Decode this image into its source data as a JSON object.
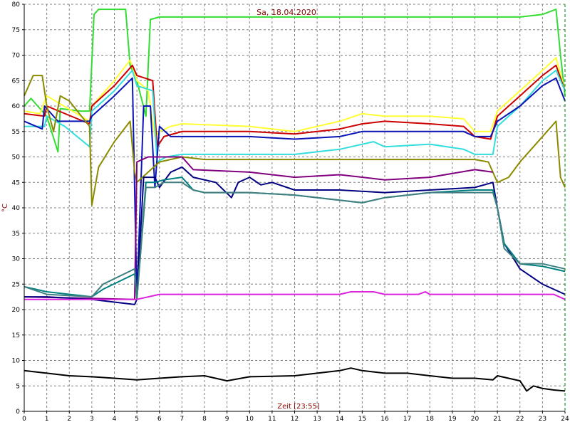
{
  "chart_data": {
    "type": "line",
    "title": "Sa, 18.04.2020",
    "xlabel": "Zeit [23:55]",
    "ylabel": "°C",
    "xlim": [
      0,
      24
    ],
    "ylim": [
      0,
      80
    ],
    "x_ticks": [
      0,
      1,
      2,
      3,
      4,
      5,
      6,
      7,
      8,
      9,
      10,
      11,
      12,
      13,
      14,
      15,
      16,
      17,
      18,
      19,
      20,
      21,
      22,
      23,
      24
    ],
    "y_ticks": [
      0,
      5,
      10,
      15,
      20,
      25,
      30,
      35,
      40,
      45,
      50,
      55,
      60,
      65,
      70,
      75,
      80
    ],
    "grid": true,
    "colors": {
      "grid": "#808080",
      "axis": "#000000",
      "title": "#8b0000",
      "right_marker": "#008000"
    },
    "series": [
      {
        "color": "#33dd33",
        "points": [
          [
            0,
            60
          ],
          [
            0.3,
            61.5
          ],
          [
            0.7,
            59.5
          ],
          [
            1.0,
            58
          ],
          [
            1.5,
            51
          ],
          [
            1.6,
            59.5
          ],
          [
            2.5,
            59
          ],
          [
            2.9,
            59
          ],
          [
            3.1,
            78
          ],
          [
            3.3,
            79
          ],
          [
            4.5,
            79
          ],
          [
            4.7,
            68
          ],
          [
            5.0,
            65
          ],
          [
            5.4,
            58
          ],
          [
            5.6,
            77
          ],
          [
            6.0,
            77.5
          ],
          [
            8,
            77.5
          ],
          [
            10,
            77.5
          ],
          [
            12,
            77.5
          ],
          [
            14,
            77.5
          ],
          [
            16,
            77.5
          ],
          [
            18,
            77.5
          ],
          [
            20,
            77.5
          ],
          [
            21,
            77.5
          ],
          [
            22,
            77.5
          ],
          [
            23,
            78
          ],
          [
            23.6,
            79
          ],
          [
            23.8,
            70
          ],
          [
            24,
            62
          ]
        ]
      },
      {
        "color": "#ffff33",
        "points": [
          [
            0,
            59
          ],
          [
            0.7,
            58.5
          ],
          [
            1.0,
            62
          ],
          [
            2.9,
            57
          ],
          [
            3.0,
            60
          ],
          [
            4.0,
            65
          ],
          [
            4.7,
            69
          ],
          [
            5.0,
            65
          ],
          [
            5.5,
            63
          ],
          [
            5.8,
            54
          ],
          [
            6.0,
            55
          ],
          [
            6.5,
            56
          ],
          [
            7,
            56.5
          ],
          [
            10,
            56
          ],
          [
            12,
            55
          ],
          [
            14,
            57
          ],
          [
            15,
            58.5
          ],
          [
            16,
            58
          ],
          [
            18,
            58
          ],
          [
            19.5,
            57.5
          ],
          [
            20,
            55
          ],
          [
            20.7,
            55
          ],
          [
            21,
            59
          ],
          [
            22,
            63
          ],
          [
            23,
            67
          ],
          [
            23.6,
            69.5
          ],
          [
            24,
            63
          ]
        ]
      },
      {
        "color": "#cc0000",
        "points": [
          [
            0,
            58.5
          ],
          [
            0.9,
            58
          ],
          [
            1.0,
            60
          ],
          [
            2.9,
            56.5
          ],
          [
            3.0,
            60
          ],
          [
            4.0,
            64
          ],
          [
            4.8,
            68
          ],
          [
            5.0,
            66
          ],
          [
            5.7,
            65
          ],
          [
            5.9,
            52
          ],
          [
            6.2,
            54
          ],
          [
            7,
            55
          ],
          [
            10,
            55
          ],
          [
            12,
            54.5
          ],
          [
            14,
            55.5
          ],
          [
            15,
            56.5
          ],
          [
            16,
            57
          ],
          [
            18,
            56.5
          ],
          [
            19.5,
            56
          ],
          [
            20,
            54
          ],
          [
            20.7,
            53.5
          ],
          [
            21,
            58
          ],
          [
            22,
            62
          ],
          [
            23,
            66
          ],
          [
            23.6,
            68
          ],
          [
            24,
            63
          ]
        ]
      },
      {
        "color": "#33dddd",
        "points": [
          [
            0,
            56
          ],
          [
            0.9,
            56
          ],
          [
            1.0,
            58
          ],
          [
            1.8,
            56
          ],
          [
            2.9,
            52
          ],
          [
            3.0,
            59
          ],
          [
            4.0,
            63
          ],
          [
            4.8,
            67
          ],
          [
            5.0,
            64
          ],
          [
            5.7,
            63
          ],
          [
            5.9,
            49
          ],
          [
            6.3,
            50
          ],
          [
            7,
            50.5
          ],
          [
            10,
            50.5
          ],
          [
            12,
            50.5
          ],
          [
            14,
            51.5
          ],
          [
            15.5,
            53
          ],
          [
            16,
            52
          ],
          [
            18,
            52.5
          ],
          [
            19.5,
            51.5
          ],
          [
            20,
            50.5
          ],
          [
            20.8,
            50.5
          ],
          [
            21,
            56
          ],
          [
            22,
            60
          ],
          [
            23,
            65
          ],
          [
            23.6,
            67
          ],
          [
            24,
            63
          ]
        ]
      },
      {
        "color": "#0a14b4",
        "points": [
          [
            0,
            57
          ],
          [
            0.8,
            55.5
          ],
          [
            0.9,
            60
          ],
          [
            1.5,
            57
          ],
          [
            2.9,
            57
          ],
          [
            3.0,
            58
          ],
          [
            4.0,
            62
          ],
          [
            4.8,
            65.5
          ],
          [
            5.0,
            22
          ],
          [
            5.3,
            60
          ],
          [
            5.6,
            60
          ],
          [
            5.8,
            44
          ],
          [
            6.0,
            56
          ],
          [
            6.5,
            54
          ],
          [
            8,
            54
          ],
          [
            10,
            54
          ],
          [
            12,
            53.5
          ],
          [
            14,
            54
          ],
          [
            15,
            55
          ],
          [
            16,
            55
          ],
          [
            18,
            55
          ],
          [
            19.5,
            55
          ],
          [
            20,
            54
          ],
          [
            20.7,
            54
          ],
          [
            21,
            57
          ],
          [
            22,
            60
          ],
          [
            23,
            64
          ],
          [
            23.6,
            65.5
          ],
          [
            24,
            61
          ]
        ]
      },
      {
        "color": "#8b8b00",
        "points": [
          [
            0,
            62
          ],
          [
            0.4,
            66
          ],
          [
            0.8,
            66
          ],
          [
            1.0,
            60
          ],
          [
            1.3,
            55
          ],
          [
            1.6,
            62
          ],
          [
            2.0,
            61
          ],
          [
            2.9,
            56
          ],
          [
            3.0,
            40.5
          ],
          [
            3.3,
            48
          ],
          [
            4.0,
            53
          ],
          [
            4.7,
            57
          ],
          [
            4.9,
            47
          ],
          [
            5.0,
            45
          ],
          [
            5.5,
            47
          ],
          [
            6.0,
            49
          ],
          [
            7,
            50
          ],
          [
            8,
            49.5
          ],
          [
            10,
            49.5
          ],
          [
            12,
            49.5
          ],
          [
            14,
            49.5
          ],
          [
            16,
            49.5
          ],
          [
            18,
            49.5
          ],
          [
            20,
            49.5
          ],
          [
            20.6,
            49
          ],
          [
            21,
            45
          ],
          [
            21.5,
            46
          ],
          [
            22,
            49
          ],
          [
            23,
            54
          ],
          [
            23.6,
            57
          ],
          [
            23.8,
            46
          ],
          [
            24,
            44
          ]
        ]
      },
      {
        "color": "#800080",
        "points": [
          [
            0,
            22.5
          ],
          [
            4.9,
            22
          ],
          [
            5.0,
            49
          ],
          [
            5.5,
            50
          ],
          [
            7,
            50
          ],
          [
            7.5,
            47.5
          ],
          [
            10,
            47
          ],
          [
            12,
            46
          ],
          [
            14,
            46.5
          ],
          [
            16,
            45.5
          ],
          [
            18,
            46
          ],
          [
            20,
            47.5
          ],
          [
            20.8,
            47
          ]
        ]
      },
      {
        "color": "#000080",
        "points": [
          [
            0,
            22.5
          ],
          [
            1,
            22.5
          ],
          [
            3,
            22
          ],
          [
            4.9,
            21
          ],
          [
            5.0,
            22
          ],
          [
            5.3,
            46
          ],
          [
            5.8,
            46
          ],
          [
            6.0,
            44
          ],
          [
            6.5,
            47
          ],
          [
            7,
            48
          ],
          [
            7.5,
            46
          ],
          [
            8.5,
            45
          ],
          [
            9.2,
            42
          ],
          [
            9.5,
            45
          ],
          [
            10,
            46
          ],
          [
            10.5,
            44.5
          ],
          [
            11,
            45
          ],
          [
            12,
            43.5
          ],
          [
            14,
            43.5
          ],
          [
            16,
            43
          ],
          [
            18,
            43.5
          ],
          [
            20,
            44
          ],
          [
            20.8,
            45
          ],
          [
            21,
            40
          ],
          [
            21.3,
            33
          ],
          [
            22,
            28
          ],
          [
            23,
            25
          ],
          [
            24,
            23
          ]
        ]
      },
      {
        "color": "#008080",
        "points": [
          [
            0,
            24.5
          ],
          [
            1,
            23.5
          ],
          [
            3,
            22.5
          ],
          [
            3.5,
            24
          ],
          [
            4.9,
            27
          ],
          [
            5.0,
            22
          ],
          [
            5.4,
            45
          ],
          [
            5.8,
            45
          ],
          [
            6.2,
            45.5
          ],
          [
            7,
            46
          ],
          [
            7.5,
            43.5
          ],
          [
            8,
            43
          ],
          [
            10,
            43
          ],
          [
            12,
            42.5
          ],
          [
            13,
            42
          ],
          [
            15,
            41
          ],
          [
            16,
            42
          ],
          [
            18,
            43
          ],
          [
            20,
            43.5
          ],
          [
            20.8,
            43.5
          ],
          [
            21,
            40
          ],
          [
            21.3,
            33
          ],
          [
            22,
            29
          ],
          [
            23,
            28.5
          ],
          [
            24,
            27.5
          ]
        ]
      },
      {
        "color": "#408080",
        "points": [
          [
            0,
            24.5
          ],
          [
            1,
            23
          ],
          [
            3,
            22.5
          ],
          [
            3.5,
            25
          ],
          [
            4.9,
            28
          ],
          [
            5.0,
            22
          ],
          [
            5.4,
            44
          ],
          [
            5.8,
            44
          ],
          [
            6.2,
            45
          ],
          [
            7,
            45
          ],
          [
            7.5,
            43.5
          ],
          [
            8,
            43
          ],
          [
            10,
            43
          ],
          [
            12,
            42.5
          ],
          [
            13,
            42
          ],
          [
            15,
            41
          ],
          [
            16,
            42
          ],
          [
            18,
            43
          ],
          [
            20,
            43
          ],
          [
            20.8,
            43
          ],
          [
            21,
            40
          ],
          [
            21.3,
            32
          ],
          [
            22,
            29
          ],
          [
            23,
            29
          ],
          [
            24,
            28
          ]
        ]
      },
      {
        "color": "#dd22dd",
        "points": [
          [
            0,
            22
          ],
          [
            5,
            22
          ],
          [
            6,
            23
          ],
          [
            10,
            23
          ],
          [
            14,
            23
          ],
          [
            14.5,
            23.5
          ],
          [
            15.5,
            23.5
          ],
          [
            16,
            23
          ],
          [
            17.5,
            23
          ],
          [
            17.8,
            23.5
          ],
          [
            18,
            23
          ],
          [
            20,
            23
          ],
          [
            22,
            23
          ],
          [
            23.5,
            23
          ],
          [
            24,
            22
          ]
        ]
      },
      {
        "color": "#000000",
        "points": [
          [
            0,
            8
          ],
          [
            1,
            7.5
          ],
          [
            2,
            7
          ],
          [
            3,
            6.8
          ],
          [
            4,
            6.5
          ],
          [
            5,
            6.2
          ],
          [
            6,
            6.5
          ],
          [
            7,
            6.8
          ],
          [
            8,
            7
          ],
          [
            9,
            6
          ],
          [
            10,
            6.8
          ],
          [
            12,
            7
          ],
          [
            13,
            7.5
          ],
          [
            14,
            8
          ],
          [
            14.5,
            8.5
          ],
          [
            15,
            8
          ],
          [
            16,
            7.5
          ],
          [
            17,
            7.5
          ],
          [
            18,
            7
          ],
          [
            19,
            6.5
          ],
          [
            20,
            6.5
          ],
          [
            20.8,
            6.2
          ],
          [
            21,
            7
          ],
          [
            22,
            6
          ],
          [
            22.3,
            4
          ],
          [
            22.6,
            5
          ],
          [
            23,
            4.5
          ],
          [
            23.5,
            4.2
          ],
          [
            24,
            4
          ]
        ]
      }
    ]
  }
}
